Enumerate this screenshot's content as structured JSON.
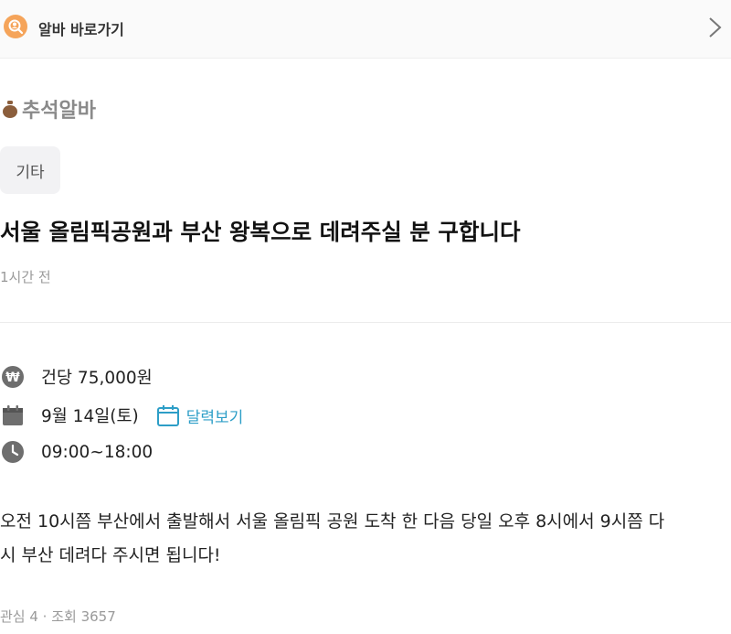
{
  "topbar": {
    "label": "알바 바로가기"
  },
  "category": {
    "label": "추석알바"
  },
  "tag": "기타",
  "post": {
    "title": "서울 올림픽공원과 부산 왕복으로 데려주실 분 구합니다",
    "time": "1시간 전"
  },
  "info": {
    "pay": "건당 75,000원",
    "date": "9월 14일(토)",
    "calendar_link": "달력보기",
    "hours": "09:00~18:00"
  },
  "description": {
    "line1": "오전 10시쯤 부산에서 출발해서 서울 올림픽 공원 도착 한 다음 당일 오후 8시에서 9시쯤 다",
    "line2": "시 부산 데려다 주시면 됩니다!"
  },
  "footer": {
    "text": "관심 4 · 조회 3657"
  },
  "colors": {
    "accent": "#2d9ec7",
    "badge": "#f5a45a",
    "icon": "#6e6e6e"
  }
}
